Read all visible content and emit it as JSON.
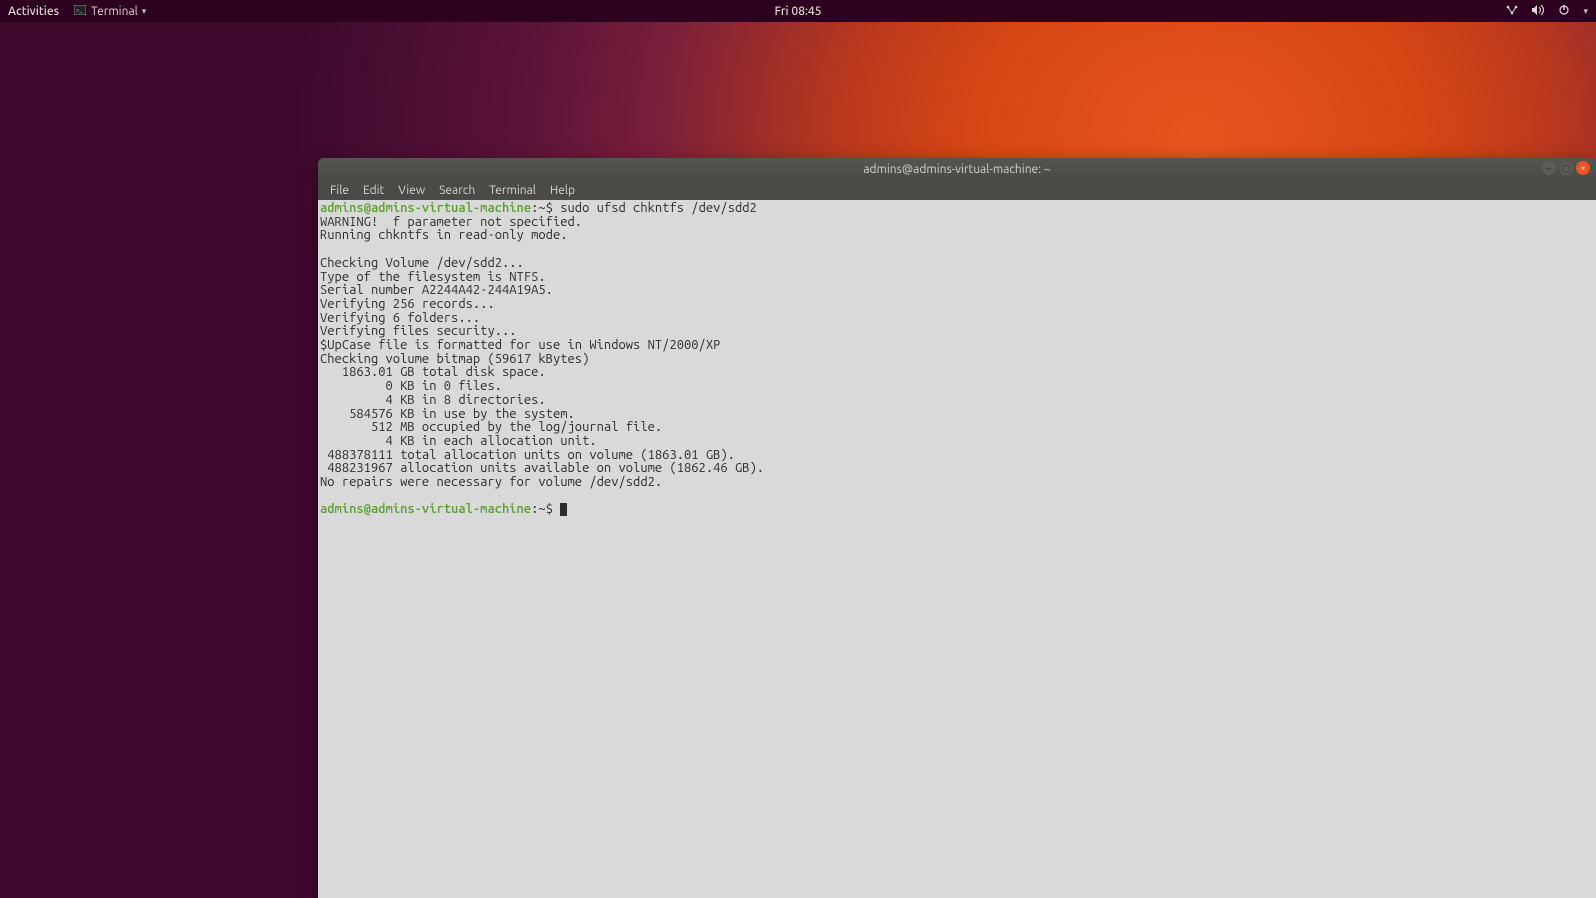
{
  "topbar": {
    "activities": "Activities",
    "app_label": "Terminal",
    "clock": "Fri 08:45",
    "icons": {
      "network": "network-icon",
      "volume": "volume-icon",
      "power": "power-icon",
      "caret": "▾"
    }
  },
  "window": {
    "title": "admins@admins-virtual-machine: ~",
    "menu": [
      "File",
      "Edit",
      "View",
      "Search",
      "Terminal",
      "Help"
    ]
  },
  "terminal": {
    "prompt_user": "admins@admins-virtual-machine",
    "prompt_path": "~",
    "prompt_symbol": "$",
    "command": "sudo ufsd chkntfs /dev/sdd2",
    "output": [
      "WARNING!  f parameter not specified.",
      "Running chkntfs in read-only mode.",
      "",
      "Checking Volume /dev/sdd2...",
      "Type of the filesystem is NTFS.",
      "Serial number A2244A42-244A19A5.",
      "Verifying 256 records...",
      "Verifying 6 folders...",
      "Verifying files security...",
      "$UpCase file is formatted for use in Windows NT/2000/XP",
      "Checking volume bitmap (59617 kBytes)",
      "   1863.01 GB total disk space.",
      "         0 KB in 0 files.",
      "         4 KB in 8 directories.",
      "    584576 KB in use by the system.",
      "       512 MB occupied by the log/journal file.",
      "         4 KB in each allocation unit.",
      " 488378111 total allocation units on volume (1863.01 GB).",
      " 488231967 allocation units available on volume (1862.46 GB).",
      "No repairs were necessary for volume /dev/sdd2."
    ]
  }
}
